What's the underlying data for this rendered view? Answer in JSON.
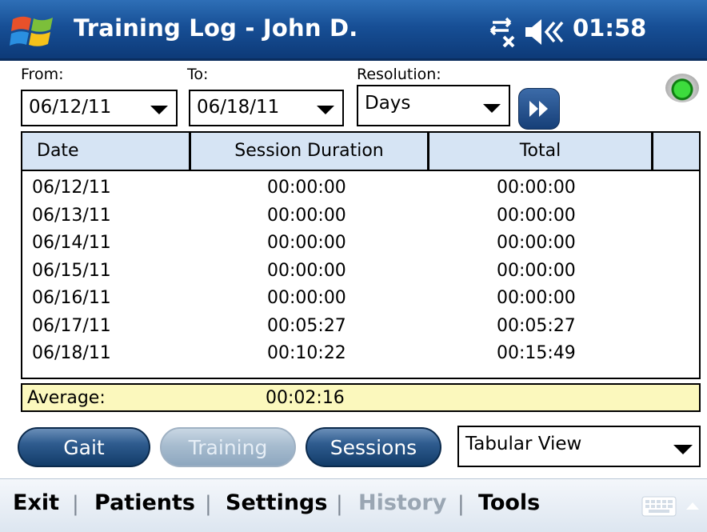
{
  "window": {
    "title": "Training Log - John D.",
    "clock": "01:58"
  },
  "filters": {
    "from_label": "From:",
    "from_value": "06/12/11",
    "to_label": "To:",
    "to_value": "06/18/11",
    "resolution_label": "Resolution:",
    "resolution_value": "Days"
  },
  "table": {
    "headers": [
      "Date",
      "Session Duration",
      "Total"
    ],
    "rows": [
      [
        "06/12/11",
        "00:00:00",
        "00:00:00"
      ],
      [
        "06/13/11",
        "00:00:00",
        "00:00:00"
      ],
      [
        "06/14/11",
        "00:00:00",
        "00:00:00"
      ],
      [
        "06/15/11",
        "00:00:00",
        "00:00:00"
      ],
      [
        "06/16/11",
        "00:00:00",
        "00:00:00"
      ],
      [
        "06/17/11",
        "00:05:27",
        "00:05:27"
      ],
      [
        "06/18/11",
        "00:10:22",
        "00:15:49"
      ]
    ]
  },
  "average": {
    "label": "Average:",
    "value": "00:02:16"
  },
  "buttons": {
    "gait": "Gait",
    "training": "Training",
    "sessions": "Sessions"
  },
  "view": {
    "value": "Tabular View"
  },
  "menu": {
    "exit": "Exit",
    "patients": "Patients",
    "settings": "Settings",
    "history": "History",
    "tools": "Tools",
    "separator": "|"
  },
  "colors": {
    "titlebar": "#174f96",
    "table_header": "#d6e4f4",
    "average_bg": "#fbf8bd",
    "status_led": "#3ddc3d"
  },
  "icons": {
    "start": "windows-flag-icon",
    "connectivity": "connection-x-icon",
    "volume": "speaker-muted-icon",
    "go": "fast-forward-icon",
    "status": "green-led-icon",
    "keyboard": "keyboard-icon"
  }
}
